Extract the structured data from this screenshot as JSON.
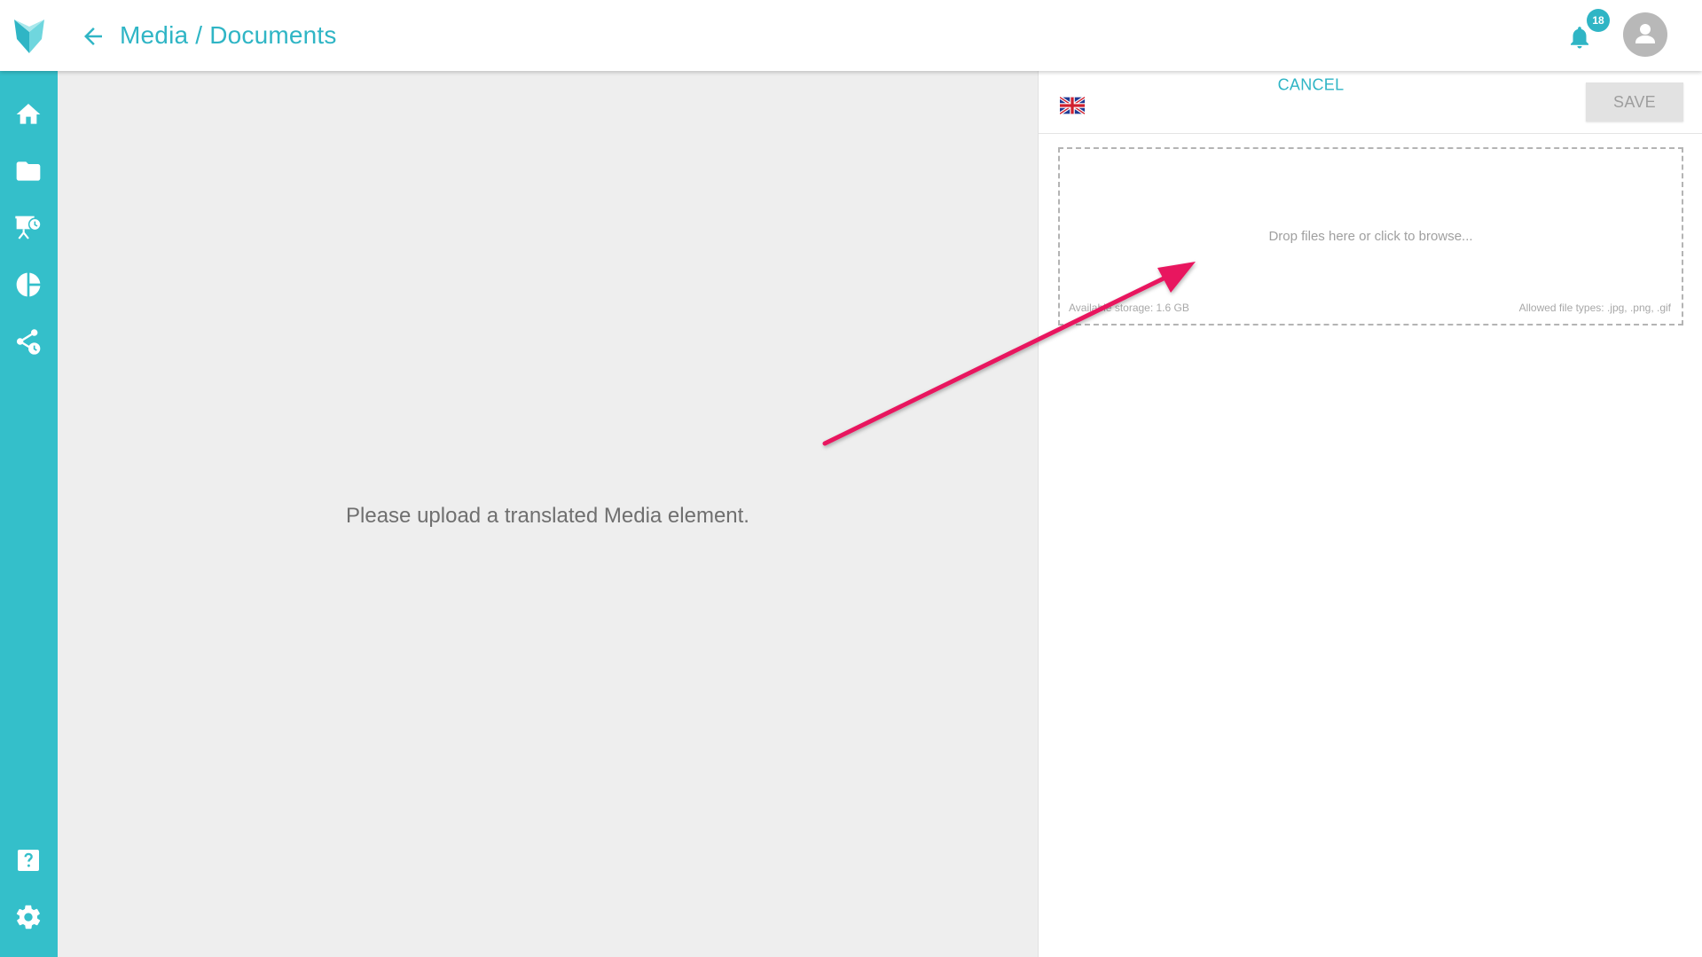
{
  "header": {
    "title": "Media / Documents",
    "notification_count": "18"
  },
  "sidebar": {
    "items": [
      {
        "icon": "home-icon"
      },
      {
        "icon": "folder-icon"
      },
      {
        "icon": "presentation-schedule-icon"
      },
      {
        "icon": "pie-chart-icon"
      },
      {
        "icon": "share-schedule-icon"
      },
      {
        "icon": "help-icon"
      },
      {
        "icon": "settings-icon"
      }
    ]
  },
  "left_panel": {
    "message": "Please upload a translated Media element."
  },
  "right_panel": {
    "language_flag": "uk-flag-icon",
    "cancel_label": "CANCEL",
    "save_label": "SAVE",
    "dropzone": {
      "prompt": "Drop files here or click to browse...",
      "storage": "Available storage: 1.6 GB",
      "allowed_types": "Allowed file types: .jpg, .png, .gif"
    }
  },
  "colors": {
    "accent": "#34bfca",
    "annotation_arrow": "#e8195f"
  }
}
